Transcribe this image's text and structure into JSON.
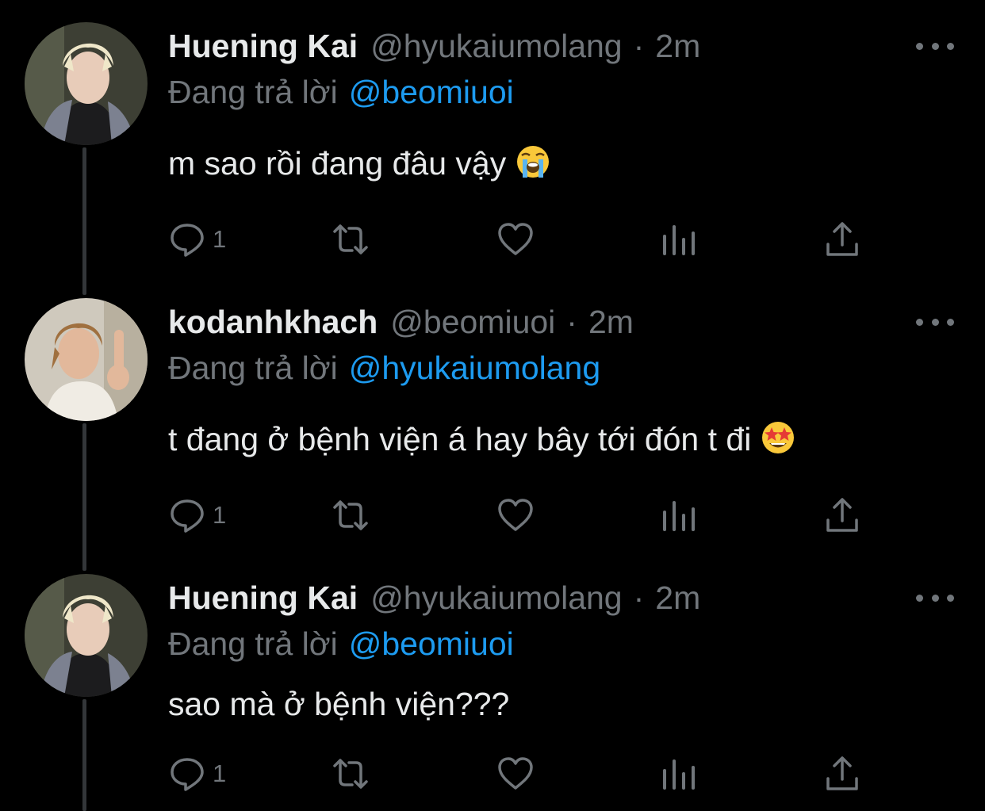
{
  "colors": {
    "background": "#000000",
    "text": "#e7e9ea",
    "muted": "#71767b",
    "accent": "#1d9bf0",
    "thread_line": "#333639"
  },
  "tweets": [
    {
      "name": "Huening Kai",
      "handle": "@hyukaiumolang",
      "dot": "·",
      "time": "2m",
      "reply_prefix": "Đang trả lời",
      "reply_to": "@beomiuoi",
      "text": "m sao rồi đang đâu vậy",
      "emoji": "loudly-crying-face-emoji",
      "actions": {
        "reply_count": "1",
        "icons": [
          "reply-icon",
          "retweet-icon",
          "like-icon",
          "analytics-icon",
          "share-icon"
        ]
      }
    },
    {
      "name": "kodanhkhach",
      "handle": "@beomiuoi",
      "dot": "·",
      "time": "2m",
      "reply_prefix": "Đang trả lời",
      "reply_to": "@hyukaiumolang",
      "text": "t đang ở bệnh viện á hay bây tới đón t đi",
      "emoji": "star-struck-emoji",
      "actions": {
        "reply_count": "1",
        "icons": [
          "reply-icon",
          "retweet-icon",
          "like-icon",
          "analytics-icon",
          "share-icon"
        ]
      }
    },
    {
      "name": "Huening Kai",
      "handle": "@hyukaiumolang",
      "dot": "·",
      "time": "2m",
      "reply_prefix": "Đang trả lời",
      "reply_to": "@beomiuoi",
      "text": "sao mà ở bệnh viện???",
      "emoji": "",
      "actions": {
        "reply_count": "1",
        "icons": [
          "reply-icon",
          "retweet-icon",
          "like-icon",
          "analytics-icon",
          "share-icon"
        ]
      }
    }
  ]
}
